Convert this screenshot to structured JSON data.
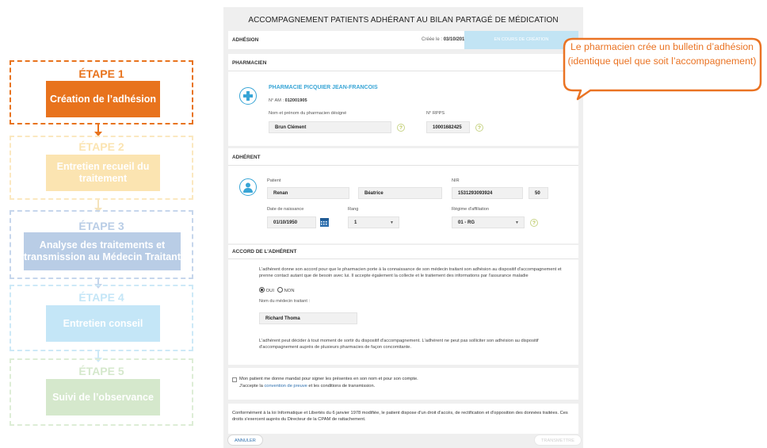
{
  "steps": [
    {
      "title": "ÉTAPE 1",
      "label": "Création de l’adhésion"
    },
    {
      "title": "ÉTAPE 2",
      "label": "Entretien recueil du traitement"
    },
    {
      "title": "ÉTAPE 3",
      "label": "Analyse des traitements et transmission au Médecin Traitant"
    },
    {
      "title": "ÉTAPE 4",
      "label": "Entretien conseil"
    },
    {
      "title": "ÉTAPE 5",
      "label": "Suivi de l’observance"
    }
  ],
  "colors": {
    "step1": "#e8731d",
    "step2": "#fbe4b1",
    "step3": "#b9cde6",
    "step4": "#c4e6f7",
    "step5": "#d5e8cc",
    "accent_blue": "#38a5d6",
    "callout": "#ea7323",
    "status_bg": "#c2e4f4"
  },
  "form": {
    "title": "ACCOMPAGNEMENT PATIENTS ADHÉRANT AU BILAN PARTAGÉ DE MÉDICATION",
    "tab_adhesion": "ADHÉSION",
    "created_label": "Créée le : ",
    "created_date": "03/10/2018",
    "status": "EN COURS DE CRÉATION",
    "pharmacien": {
      "section": "PHARMACIEN",
      "name": "PHARMACIE PICQUIER JEAN-FRANCOIS",
      "am_label": "N° AM : ",
      "am_value": "012001905",
      "designated_label": "Nom et prénom du pharmacien désigné",
      "designated_value": "Brun Clément",
      "rpps_label": "N° RPPS",
      "rpps_value": "10001682425"
    },
    "adherent": {
      "section": "ADHÉRENT",
      "patient_label": "Patient",
      "last_name": "Renan",
      "first_name": "Béatrice",
      "nir_label": "NIR",
      "nir_value": "1531293093924",
      "nir_key": "50",
      "birth_label": "Date de naissance",
      "birth_value": "01/10/1950",
      "rang_label": "Rang",
      "rang_value": "1",
      "regime_label": "Régime d'affiliation",
      "regime_value": "01 - RG"
    },
    "accord": {
      "section": "ACCORD DE L'ADHÉRENT",
      "text1": "L'adhérent donne son accord pour que le pharmacien porte à la connaissance de son médecin traitant son adhésion au dispositif d'accompagnement et prenne contact autant que de besoin avec lui. Il accepte également la collecte et le traitement des informations par l'assurance maladie",
      "oui": "OUI",
      "non": "NON",
      "doctor_label": "Nom du médecin traitant :",
      "doctor_value": "Richard Thoma",
      "text2": "L'adhérent peut décider à tout moment de sortir du dispositif d'accompagnement. L'adhérent ne peut pas solliciter son adhésion au dispositif d'accompagnement auprès de plusieurs pharmacies de façon concomitante."
    },
    "mandat": {
      "line1": "Mon patient me donne mandat pour signer les présentes en son nom et pour son compte.",
      "line2_before": "J'accepte la ",
      "link": "convention de preuve",
      "line2_after": " et les conditions de transmission."
    },
    "legal": "Conformément à la loi Informatique et Libertés du 6 janvier 1978 modifiée, le patient dispose d'un droit d'accès, de rectification et d'opposition des données traitées. Ces droits s'exercent auprès du Directeur de la CPAM de rattachement.",
    "cancel": "ANNULER",
    "transmit": "TRANSMETTRE"
  },
  "callout": {
    "text": "Le pharmacien crée un bulletin d’adhésion  (identique quel que soit l’accompagnement)"
  }
}
